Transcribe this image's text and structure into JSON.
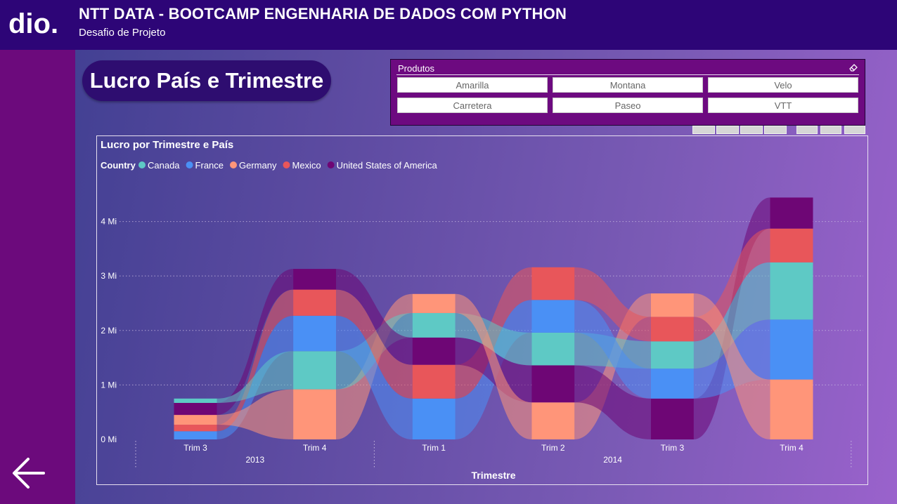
{
  "header": {
    "title": "NTT DATA - BOOTCAMP ENGENHARIA DE DADOS COM PYTHON",
    "subtitle": "Desafio de Projeto",
    "logo_text": "dio."
  },
  "page": {
    "title": "Lucro País e Trimestre"
  },
  "slicer": {
    "title": "Produtos",
    "options": [
      "Amarilla",
      "Montana",
      "Velo",
      "Carretera",
      "Paseo",
      "VTT"
    ]
  },
  "nav": {
    "back_icon": "arrow-left-icon"
  },
  "chart_data": {
    "type": "ribbon",
    "title": "Lucro por Trimestre e País",
    "legend_title": "Country",
    "legend_position": "top-left",
    "xlabel": "Trimestre",
    "ylabel": "",
    "ylim": [
      0,
      4.6
    ],
    "yticks": [
      "0 Mi",
      "1 Mi",
      "2 Mi",
      "3 Mi",
      "4 Mi"
    ],
    "grid": true,
    "categories": [
      "Trim 3",
      "Trim 4",
      "Trim 1",
      "Trim 2",
      "Trim 3",
      "Trim 4"
    ],
    "years": [
      {
        "label": "2013",
        "span": [
          0,
          1
        ]
      },
      {
        "label": "2014",
        "span": [
          2,
          5
        ]
      }
    ],
    "series": [
      {
        "name": "Canada",
        "color": "#5ec9c5",
        "values": [
          0.08,
          0.7,
          0.45,
          0.6,
          0.5,
          1.05
        ]
      },
      {
        "name": "France",
        "color": "#4a90f5",
        "values": [
          0.15,
          0.65,
          0.75,
          0.6,
          0.55,
          1.1
        ]
      },
      {
        "name": "Germany",
        "color": "#ff9579",
        "values": [
          0.18,
          0.92,
          0.35,
          0.68,
          0.43,
          1.1
        ]
      },
      {
        "name": "Mexico",
        "color": "#e8565a",
        "values": [
          0.12,
          0.48,
          0.62,
          0.6,
          0.45,
          0.62
        ]
      },
      {
        "name": "United States of America",
        "color": "#6e0675",
        "values": [
          0.22,
          0.38,
          0.5,
          0.68,
          0.75,
          0.57
        ]
      }
    ],
    "stack_order": [
      [
        1,
        3,
        2,
        4,
        0
      ],
      [
        2,
        0,
        1,
        3,
        4
      ],
      [
        1,
        3,
        4,
        0,
        2
      ],
      [
        2,
        4,
        0,
        1,
        3
      ],
      [
        4,
        1,
        0,
        3,
        2
      ],
      [
        2,
        1,
        0,
        3,
        4
      ]
    ]
  },
  "colors": {
    "topbar": "#2d0577",
    "leftbar": "#6c0a7c",
    "pill": "#2e0d70",
    "slicer_bg": "#6d0a80"
  }
}
